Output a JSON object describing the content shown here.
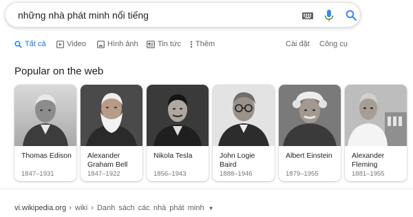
{
  "search": {
    "query": "những nhà phát minh nổi tiếng"
  },
  "tabs": [
    {
      "label": "Tất cả",
      "icon": "search-icon",
      "active": true
    },
    {
      "label": "Video",
      "icon": "video-icon"
    },
    {
      "label": "Hình ảnh",
      "icon": "image-icon"
    },
    {
      "label": "Tin tức",
      "icon": "news-icon"
    },
    {
      "label": "Thêm",
      "icon": "more-icon"
    }
  ],
  "tools": {
    "settings_label": "Cài đặt",
    "tools_label": "Công cụ"
  },
  "section": {
    "title": "Popular on the web"
  },
  "cards": [
    {
      "name": "Thomas Edison",
      "years": "1847–1931"
    },
    {
      "name": "Alexander Graham Bell",
      "years": "1847–1922"
    },
    {
      "name": "Nikola Tesla",
      "years": "1856–1943"
    },
    {
      "name": "John Logie Baird",
      "years": "1888–1946"
    },
    {
      "name": "Albert Einstein",
      "years": "1879–1955"
    },
    {
      "name": "Alexander Fleming",
      "years": "1881–1955"
    }
  ],
  "result": {
    "domain": "vi.wikipedia.org",
    "path": "› wiki › Danh sách các nhà phát minh"
  },
  "colors": {
    "accent": "#1a73e8",
    "mic_blue": "#4285f4",
    "mic_red": "#ea4335",
    "secondary_text": "#70757a"
  }
}
